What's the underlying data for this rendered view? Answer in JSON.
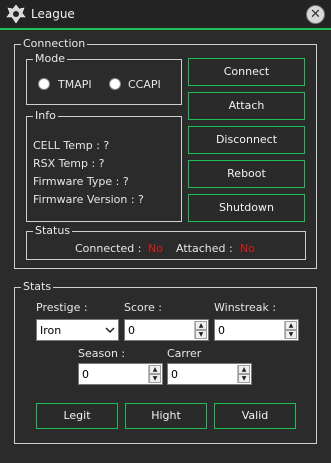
{
  "window": {
    "title": "League"
  },
  "connection": {
    "legend": "Connection",
    "mode": {
      "legend": "Mode",
      "options": [
        "TMAPI",
        "CCAPI"
      ]
    },
    "info": {
      "legend": "Info",
      "cell_temp": "CELL Temp : ?",
      "rsx_temp": "RSX Temp : ?",
      "firmware_type": "Firmware Type : ?",
      "firmware_version": "Firmware Version : ?"
    },
    "buttons": {
      "connect": "Connect",
      "attach": "Attach",
      "disconnect": "Disconnect",
      "reboot": "Reboot",
      "shutdown": "Shutdown"
    },
    "status": {
      "legend": "Status",
      "connected_label": "Connected :",
      "connected_value": "No",
      "attached_label": "Attached :",
      "attached_value": "No"
    }
  },
  "stats": {
    "legend": "Stats",
    "prestige": {
      "label": "Prestige :",
      "value": "Iron"
    },
    "score": {
      "label": "Score :",
      "value": "0"
    },
    "winstreak": {
      "label": "Winstreak :",
      "value": "0"
    },
    "season": {
      "label": "Season :",
      "value": "0"
    },
    "carrer": {
      "label": "Carrer",
      "value": "0"
    },
    "buttons": {
      "legit": "Legit",
      "hight": "Hight",
      "valid": "Valid"
    }
  },
  "colors": {
    "accent": "#1fbf57",
    "status_no": "#e01818",
    "background": "#2b2b2b"
  },
  "icons": {
    "app": "league-logo-icon",
    "close": "close-icon"
  }
}
